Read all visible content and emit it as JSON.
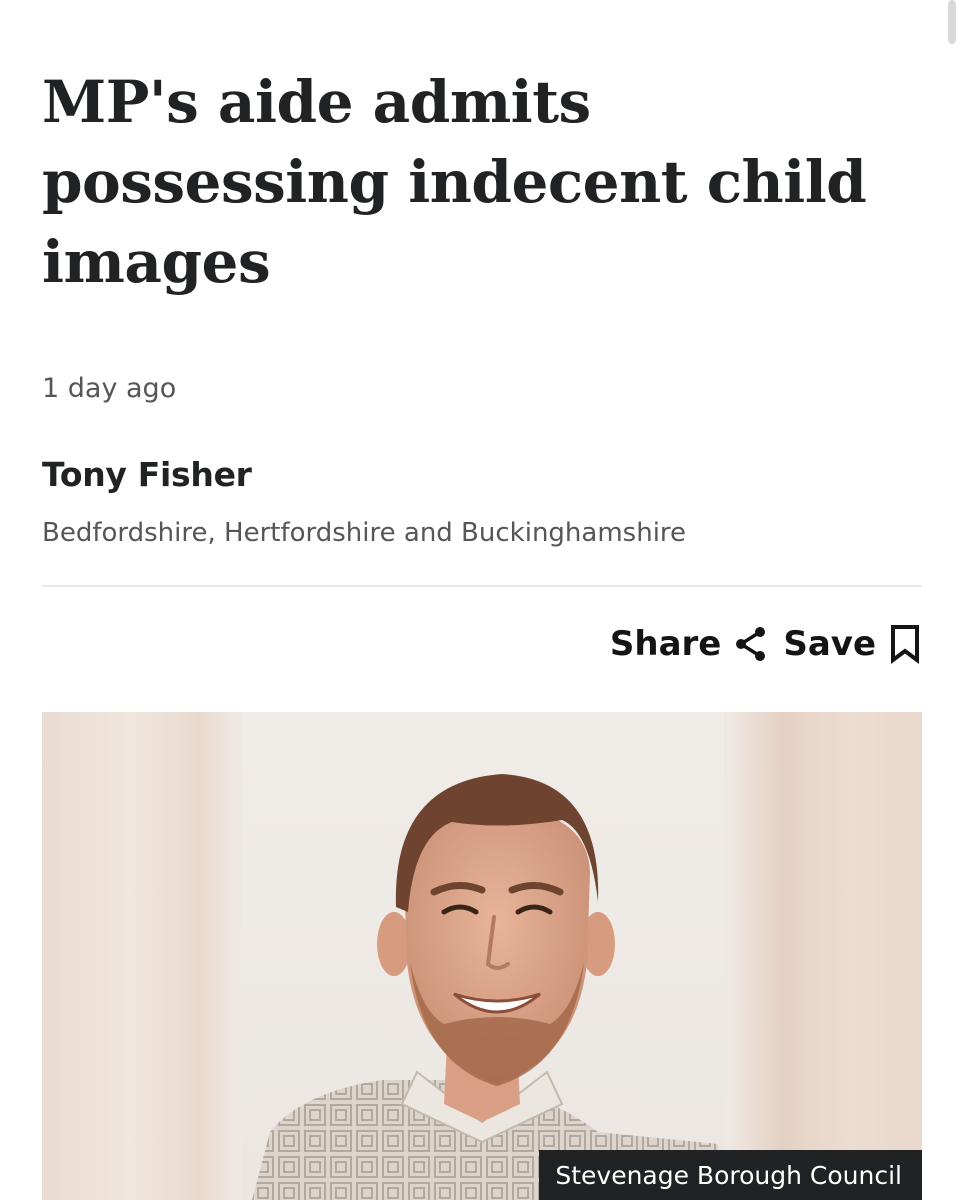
{
  "article": {
    "headline": "MP's aide admits possessing indecent child images",
    "timestamp": "1 day ago",
    "author": "Tony Fisher",
    "region": "Bedfordshire, Hertfordshire and Buckinghamshire"
  },
  "actions": {
    "share_label": "Share",
    "share_icon": "share-icon",
    "save_label": "Save",
    "save_icon": "bookmark-icon"
  },
  "image": {
    "caption": "Stevenage Borough Council"
  },
  "colors": {
    "text": "#202224",
    "secondary_text": "#545658",
    "divider": "#e6e8ea",
    "caption_background": "#202224"
  }
}
